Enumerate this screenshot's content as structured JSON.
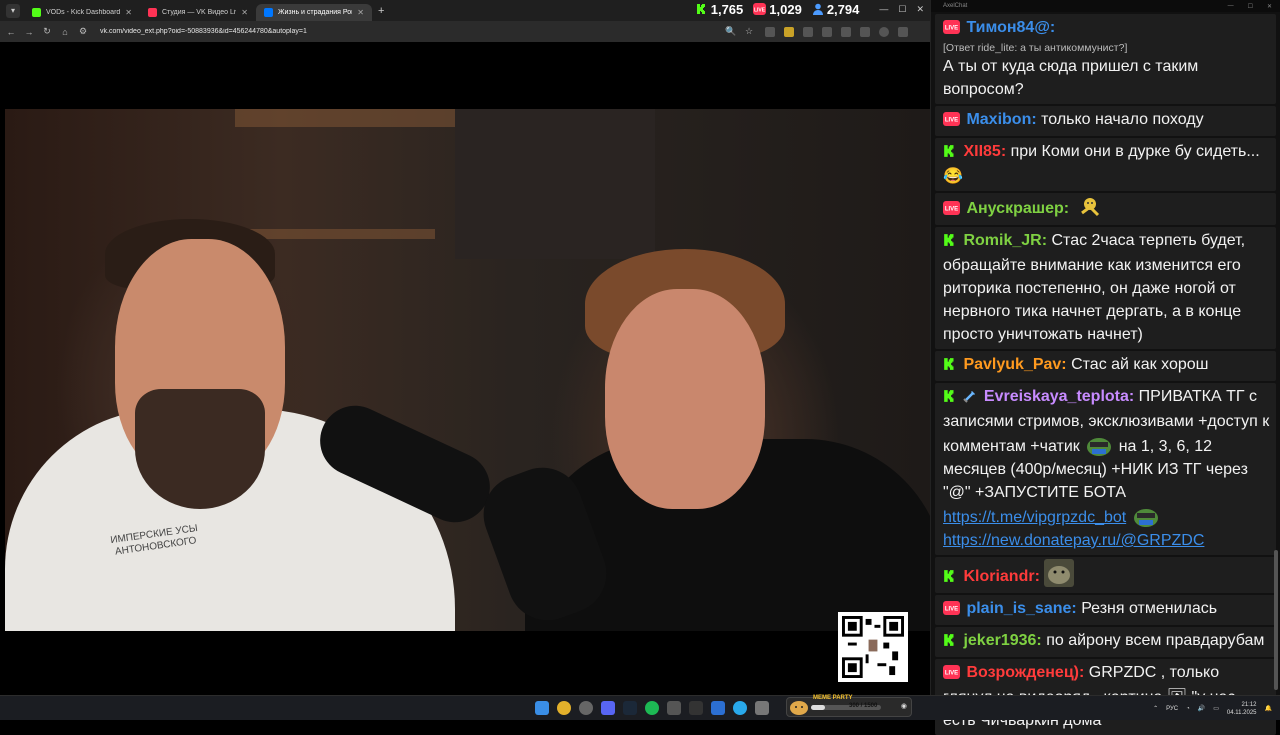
{
  "browser": {
    "tabs": [
      {
        "title": "VODs - Kick Dashboard",
        "favicon_color": "#53fc18",
        "active": false
      },
      {
        "title": "Студия — VK Видео Live",
        "favicon_color": "#ff3355",
        "active": false
      },
      {
        "title": "Жизнь и страдания Рома...",
        "favicon_color": "#0077ff",
        "active": true
      }
    ],
    "new_tab": "+",
    "url": "vk.com/video_ext.php?oid=-50883936&id=456244780&autoplay=1"
  },
  "viewer_counters": {
    "kick": "1,765",
    "vk_live": "1,029",
    "total": "2,794",
    "colors": {
      "kick": "#53fc18",
      "vk_live": "#ff3355",
      "total": "#4c9bff"
    }
  },
  "video": {
    "shirt_logo_text": "ИМПЕРСКИЕ УСЫ АНТОНОВСКОГО"
  },
  "chat": {
    "window_title": "AxelChat",
    "messages": [
      {
        "platform": "vk",
        "nick": "Тимон84@:",
        "nick_color": "#3b8eea",
        "reply": "[Ответ ride_lite: а ты антикоммунист?]",
        "text": "А ты от куда сюда пришел с таким вопросом?"
      },
      {
        "platform": "vk",
        "nick": "Maxibon:",
        "nick_color": "#3b8eea",
        "text": "только начало походу"
      },
      {
        "platform": "kick",
        "nick": "XII85:",
        "nick_color": "#ff3b3b",
        "text": "при Коми они в дурке бу сидеть...😂"
      },
      {
        "platform": "vk",
        "nick": "Анускрашер:",
        "nick_color": "#7fd142",
        "text": "",
        "emote": "dancing-figure"
      },
      {
        "platform": "kick",
        "nick": "Romik_JR:",
        "nick_color": "#7fd142",
        "text": "Стас 2часа терпеть будет, обращайте внимание как изменится его риторика постепенно, он даже ногой от нервного тика начнет дергать, а в конце просто уничтожать начнет)"
      },
      {
        "platform": "kick",
        "nick": "Pavlyuk_Pav:",
        "nick_color": "#ff9a1f",
        "text": "Стас ай как хорош"
      },
      {
        "platform": "kick",
        "nick": "Evreiskaya_teplota:",
        "nick_color": "#c78bff",
        "text_before": "ПРИВАТКА ТГ с записями стримов, эксклюзивами +доступ к комментам +чатик",
        "text_after": "на 1, 3, 6, 12 месяцев (400р/месяц) +НИК ИЗ ТГ через \"@\" +ЗАПУСТИТЕ БОТА",
        "link1": "https://t.me/vipgrpzdc_bot",
        "link2": "https://new.donatepay.ru/@GRPZDC"
      },
      {
        "platform": "kick",
        "nick": "Kloriandr:",
        "nick_color": "#ff3b3b",
        "text": "",
        "emote": "seal"
      },
      {
        "platform": "vk",
        "nick": "plain_is_sane:",
        "nick_color": "#3b8eea",
        "text": "Резня отменилась"
      },
      {
        "platform": "kick",
        "nick": "jeker1936:",
        "nick_color": "#7fd142",
        "text": "по айрону всем правдарубам"
      },
      {
        "platform": "vk",
        "nick": "Возрожденец):",
        "nick_color": "#ff3b3b",
        "text": "GRPZDC , только глянул на видеоряд , картина 🖼 \"у нас есть Чичваркин дома\"",
        "bold_prefix": "GRPZDC"
      }
    ]
  },
  "taskbar": {
    "meme_party": {
      "label": "MEME PARTY",
      "count": "300 / 1500",
      "progress": 0.2
    },
    "language": "РУС",
    "time": "21:12",
    "date": "04.11.2025"
  }
}
